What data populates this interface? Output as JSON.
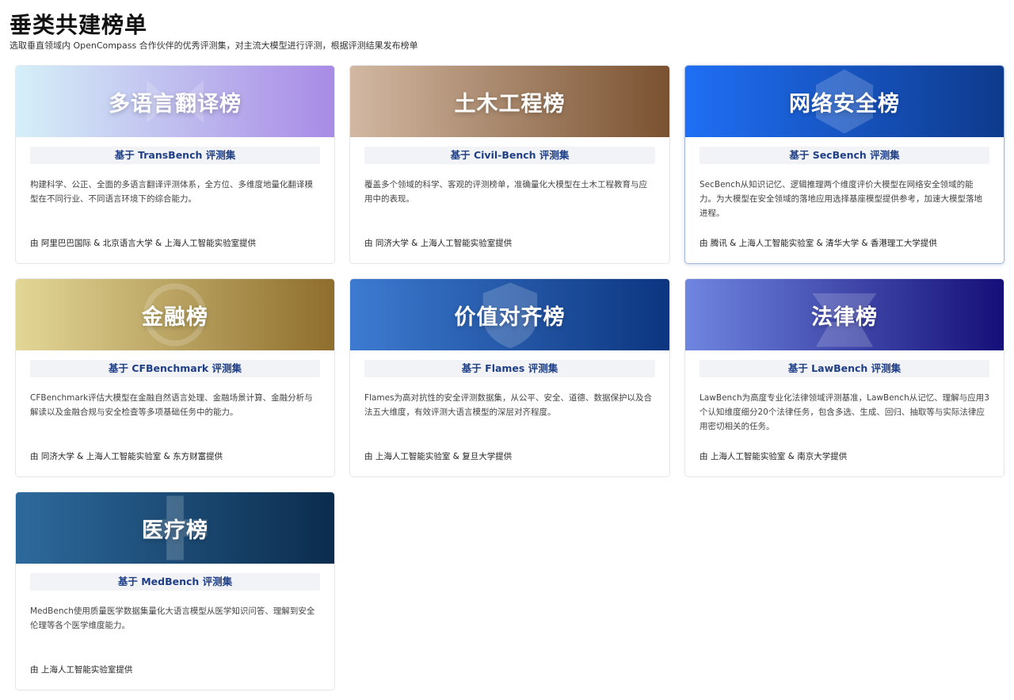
{
  "header": {
    "title": "垂类共建榜单",
    "subtitle": "选取垂直领域内 OpenCompass 合作伙伴的优秀评测集，对主流大模型进行评测，根据评测结果发布榜单"
  },
  "cards": [
    {
      "title": "多语言翻译榜",
      "subset": "基于 TransBench 评测集",
      "description": "构建科学、公正、全面的多语言翻译评测体系，全方位、多维度地量化翻译模型在不同行业、不同语言环境下的综合能力。",
      "provider": "由 阿里巴巴国际 & 北京语言大学 & 上海人工智能实验室提供",
      "colors": [
        "#d5f0f8",
        "#a98be6"
      ]
    },
    {
      "title": "土木工程榜",
      "subset": "基于 Civil-Bench 评测集",
      "description": "覆盖多个领域的科学、客观的评测榜单，准确量化大模型在土木工程教育与应用中的表现。",
      "provider": "由 同济大学 & 上海人工智能实验室提供",
      "colors": [
        "#d2b8a2",
        "#7a5230"
      ]
    },
    {
      "title": "网络安全榜",
      "subset": "基于 SecBench 评测集",
      "description": "SecBench从知识记忆、逻辑推理两个维度评价大模型在网络安全领域的能力。为大模型在安全领域的落地应用选择基座模型提供参考，加速大模型落地进程。",
      "provider": "由 腾讯 & 上海人工智能实验室 & 清华大学 & 香港理工大学提供",
      "colors": [
        "#1f6ff5",
        "#0e3a8c"
      ]
    },
    {
      "title": "金融榜",
      "subset": "基于 CFBenchmark 评测集",
      "description": "CFBenchmark评估大模型在金融自然语言处理、金融场景计算、金融分析与解读以及金融合规与安全检查等多项基础任务中的能力。",
      "provider": "由 同济大学 & 上海人工智能实验室 & 东方财富提供",
      "colors": [
        "#e3d796",
        "#8f6e2c"
      ]
    },
    {
      "title": "价值对齐榜",
      "subset": "基于 Flames 评测集",
      "description": "Flames为高对抗性的安全评测数据集，从公平、安全、道德、数据保护以及合法五大维度，有效评测大语言模型的深层对齐程度。",
      "provider": "由 上海人工智能实验室 & 复旦大学提供",
      "colors": [
        "#3d7bd0",
        "#0c357f"
      ]
    },
    {
      "title": "法律榜",
      "subset": "基于 LawBench 评测集",
      "description": "LawBench为高度专业化法律领域评测基准，LawBench从记忆、理解与应用3个认知维度细分20个法律任务，包含多选、生成、回归、抽取等与实际法律应用密切相关的任务。",
      "provider": "由 上海人工智能实验室 & 南京大学提供",
      "colors": [
        "#6f86e0",
        "#150f78"
      ]
    },
    {
      "title": "医疗榜",
      "subset": "基于 MedBench 评测集",
      "description": "MedBench使用质量医学数据集量化大语言模型从医学知识问答、理解到安全伦理等各个医学维度能力。",
      "provider": "由 上海人工智能实验室提供",
      "colors": [
        "#2d6a9c",
        "#0b2c4d"
      ]
    }
  ]
}
